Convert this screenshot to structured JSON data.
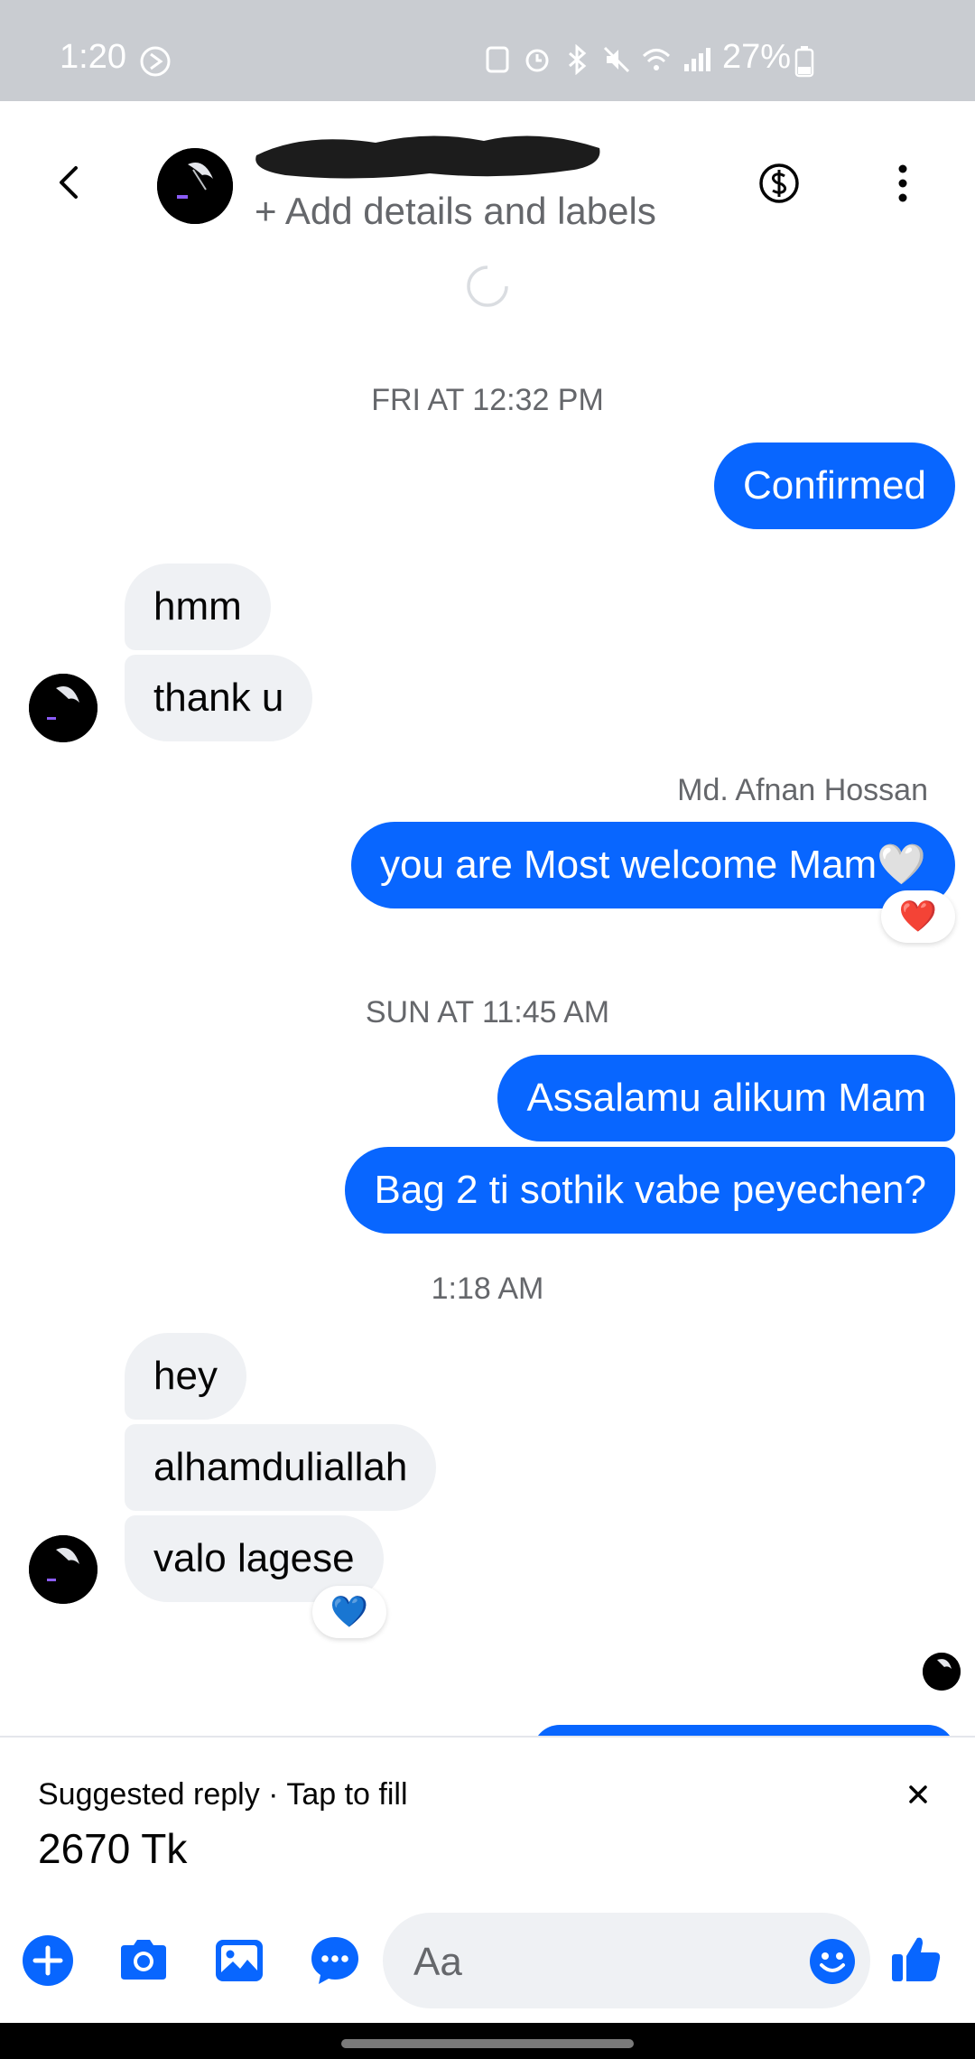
{
  "status_bar": {
    "time": "1:20",
    "battery": "27%",
    "icons": [
      "assistant-icon",
      "alarm-icon",
      "bluetooth-icon",
      "mute-icon",
      "wifi-icon",
      "signal-icon",
      "battery-icon"
    ]
  },
  "header": {
    "add_details": "+ Add details and labels"
  },
  "messages": {
    "ts1": "FRI AT 12:32 PM",
    "m1": "Confirmed",
    "m2": "hmm",
    "m3": "thank u",
    "sender": "Md. Afnan Hossan",
    "m4": "you are Most welcome Mam🤍",
    "m4_reaction": "❤️",
    "ts2": "SUN AT 11:45 AM",
    "m5": "Assalamu alikum Mam",
    "m6": "Bag 2 ti sothik vabe peyechen?",
    "ts3": "1:18 AM",
    "m7": "hey",
    "m8": "alhamduliallah",
    "m9": "valo lagese",
    "m9_reaction": "💙"
  },
  "suggestion": {
    "label": "Suggested reply · Tap to fill",
    "value": "2670 Tk"
  },
  "composer": {
    "placeholder": "Aa"
  },
  "colors": {
    "accent": "#0866ff",
    "incoming_bubble": "#eff1f4",
    "status_bar": "#c9ccd1",
    "muted_text": "#65676b"
  }
}
